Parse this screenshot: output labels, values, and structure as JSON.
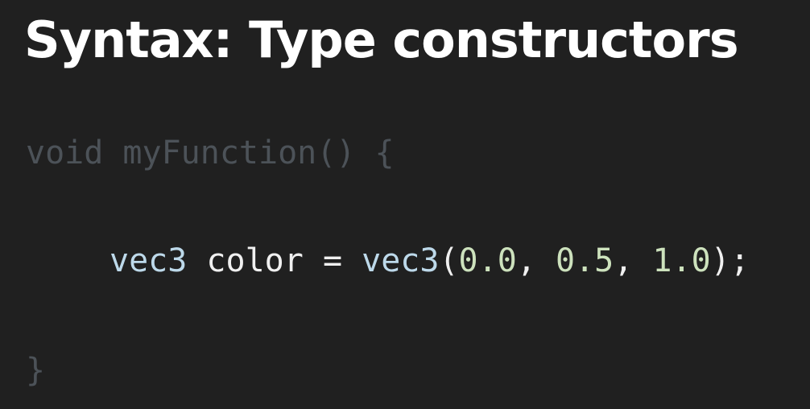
{
  "title": "Syntax: Type constructors",
  "code": {
    "open_line": {
      "keyword": "void",
      "function_name": "myFunction",
      "parens": "()",
      "brace": "{"
    },
    "body_line": {
      "decl_type": "vec3",
      "var_name": "color",
      "assign": "=",
      "constructor": "vec3",
      "open_paren": "(",
      "arg1": "0.0",
      "comma1": ",",
      "arg2": "0.5",
      "comma2": ",",
      "arg3": "1.0",
      "close": ");"
    },
    "close_line": {
      "brace": "}"
    }
  },
  "colors": {
    "background": "#202020",
    "title": "#ffffff",
    "dimmed_code": "#4c5258",
    "type_keyword": "#bdd9ea",
    "identifier": "#f0f0f0",
    "number": "#cde2bd"
  }
}
